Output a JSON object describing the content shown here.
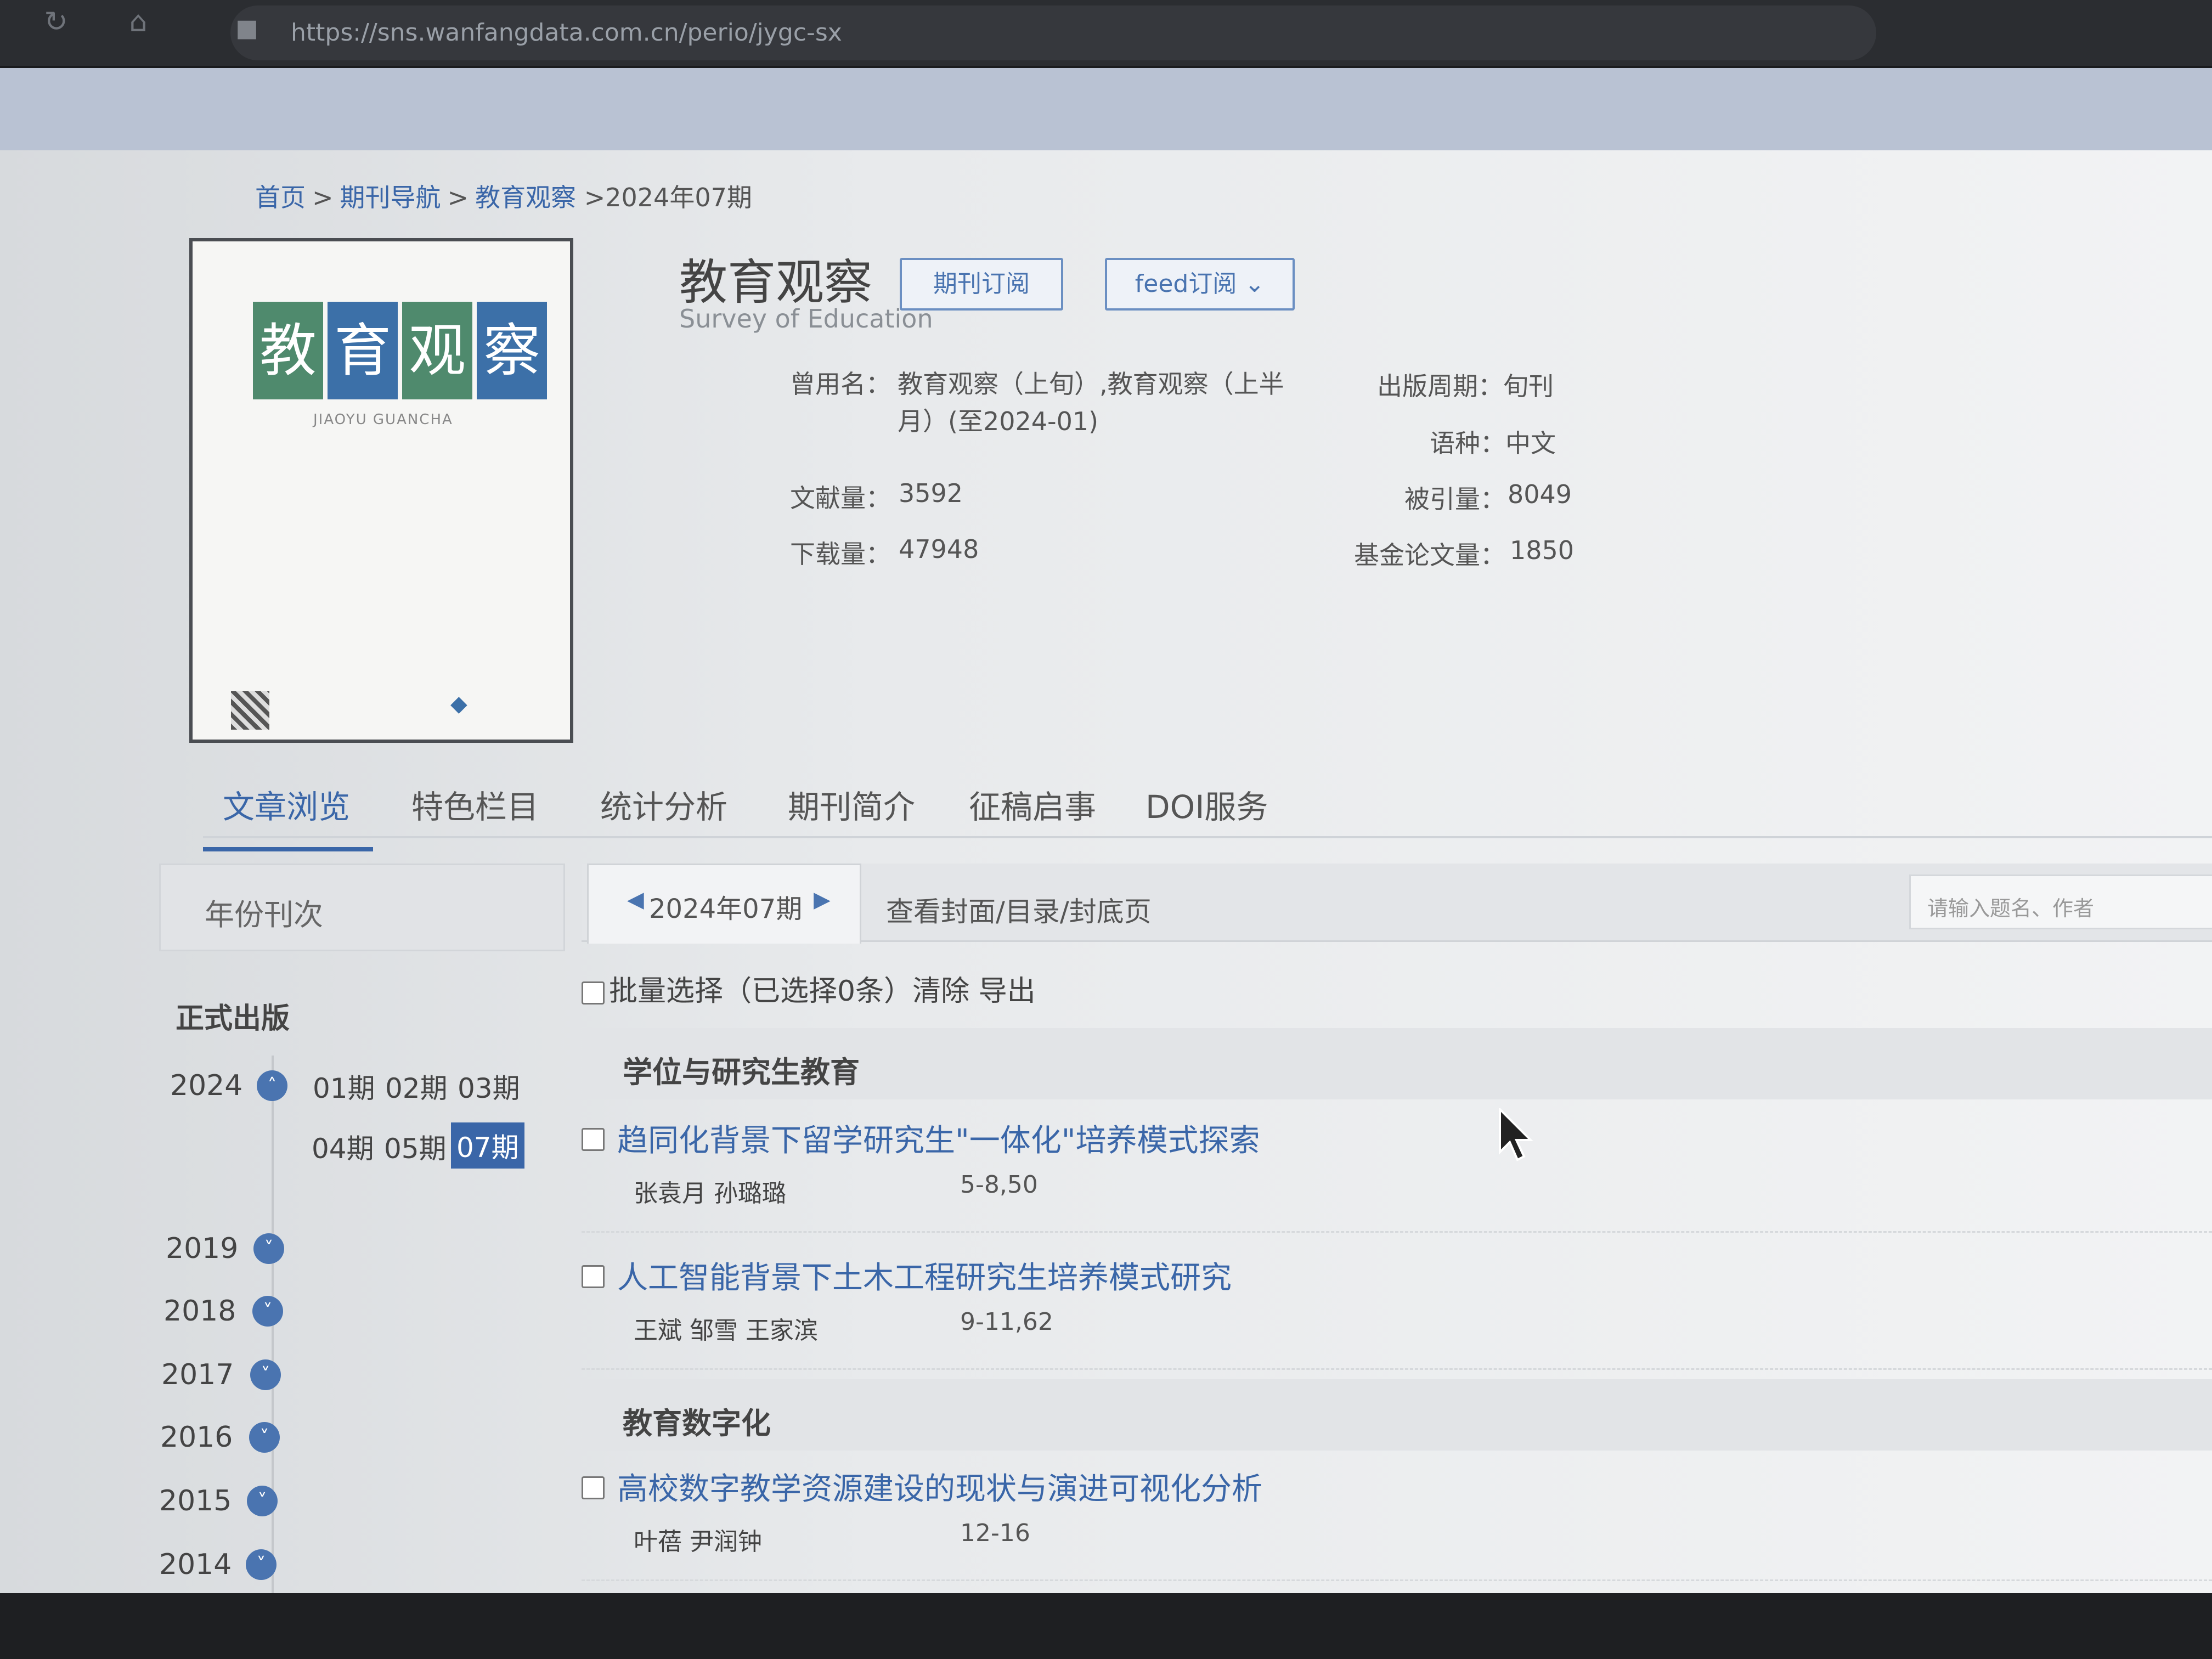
{
  "browser": {
    "url": "https://sns.wanfangdata.com.cn/perio/jygc-sx",
    "icons": [
      "refresh-icon",
      "home-icon",
      "lock-icon"
    ]
  },
  "breadcrumb": {
    "home": "首页",
    "nav": "期刊导航",
    "journal": "教育观察",
    "current": ">2024年07期",
    "sep": ">"
  },
  "cover": {
    "chars": [
      "教",
      "育",
      "观",
      "察"
    ],
    "pinyin": "JIAOYU GUANCHA"
  },
  "journal": {
    "title": "教育观察",
    "subtitle": "Survey of Education",
    "subscribe_label": "期刊订阅",
    "feed_label": "feed订阅"
  },
  "info": {
    "former_name_label": "曾用名：",
    "former_name_line1": "教育观察（上旬）,教育观察（上半",
    "former_name_line2": "月）(至2024-01)",
    "period_label": "出版周期：",
    "period": "旬刊",
    "lang_label": "语种：",
    "lang": "中文",
    "docs_label": "文献量：",
    "docs": "3592",
    "cited_label": "被引量：",
    "cited": "8049",
    "downloads_label": "下载量：",
    "downloads": "47948",
    "fund_label": "基金论文量：",
    "fund": "1850"
  },
  "tabs": [
    "文章浏览",
    "特色栏目",
    "统计分析",
    "期刊简介",
    "征稿启事",
    "DOI服务"
  ],
  "left": {
    "header": "年份刊次",
    "section": "正式出版",
    "current_year": "2024",
    "issues": [
      "01期",
      "02期",
      "03期",
      "04期",
      "05期",
      "07期"
    ],
    "years": [
      "2019",
      "2018",
      "2017",
      "2016",
      "2015",
      "2014"
    ]
  },
  "main": {
    "issue_label": "2024年07期",
    "cover_link": "查看封面/目录/封底页",
    "search_placeholder": "请输入题名、作者",
    "batch": "批量选择（已选择0条）清除 导出"
  },
  "sections": [
    {
      "name": "学位与研究生教育",
      "articles": [
        {
          "title": "趋同化背景下留学研究生\"一体化\"培养模式探索",
          "authors": "张袁月 孙璐璐",
          "pages": "5-8,50"
        },
        {
          "title": "人工智能背景下土木工程研究生培养模式研究",
          "authors": "王斌 邹雪 王家滨",
          "pages": "9-11,62"
        }
      ]
    },
    {
      "name": "教育数字化",
      "articles": [
        {
          "title": "高校数字教学资源建设的现状与演进可视化分析",
          "authors": "叶蓓 尹润钟",
          "pages": "12-16"
        }
      ]
    }
  ],
  "colors": {
    "accent": "#3a66a8",
    "cover_green": "#4f8a6d",
    "cover_blue": "#3c70a8"
  }
}
